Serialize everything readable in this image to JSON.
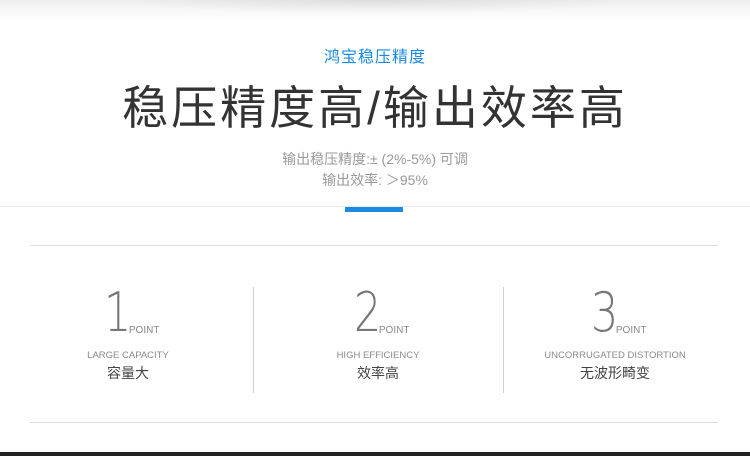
{
  "header": {
    "subtitle": "鸿宝稳压精度",
    "headline": "稳压精度高/输出效率高",
    "desc_line1": "输出稳压精度:± (2%-5%) 可调",
    "desc_line2": "输出效率:  ＞95%"
  },
  "colors": {
    "accent": "#1a8be0",
    "headline": "#333333",
    "muted": "#9a9a9a"
  },
  "features": [
    {
      "number": "1",
      "unit": "POINT",
      "en": "LARGE CAPACITY",
      "cn": "容量大"
    },
    {
      "number": "2",
      "unit": "POINT",
      "en": "HIGH EFFICIENCY",
      "cn": "效率高"
    },
    {
      "number": "3",
      "unit": "POINT",
      "en": "UNCORRUGATED DISTORTION",
      "cn": "无波形畸变"
    }
  ]
}
